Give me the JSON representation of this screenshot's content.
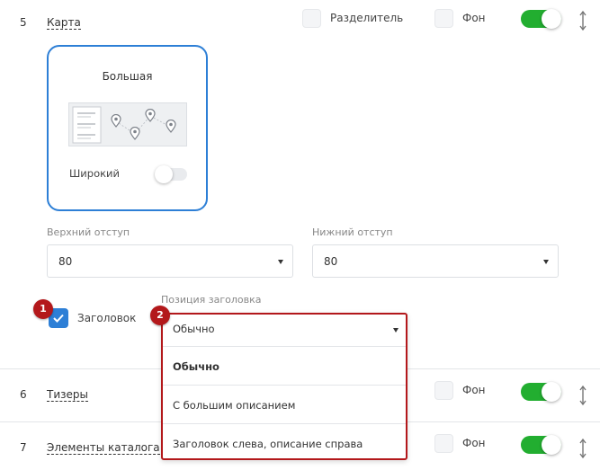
{
  "colors": {
    "accent_blue": "#2d7fd6",
    "toggle_green": "#22ae30",
    "annotation_red": "#b3181b"
  },
  "rows": [
    {
      "num": "5",
      "title": "Карта"
    },
    {
      "num": "6",
      "title": "Тизеры"
    },
    {
      "num": "7",
      "title": "Элементы каталога"
    }
  ],
  "options": {
    "divider_label": "Разделитель",
    "background_label": "Фон"
  },
  "map_card": {
    "title": "Большая",
    "wide_label": "Широкий",
    "wide_on": false
  },
  "top_margin": {
    "label": "Верхний отступ",
    "value": "80"
  },
  "bottom_margin": {
    "label": "Нижний отступ",
    "value": "80"
  },
  "heading": {
    "label": "Заголовок",
    "checked": true
  },
  "heading_position": {
    "label": "Позиция заголовка",
    "selected": "Обычно",
    "options": [
      "Обычно",
      "С большим описанием",
      "Заголовок слева, описание справа"
    ]
  },
  "annotations": [
    "1",
    "2"
  ],
  "icons": {
    "toggle": "toggle-switch-icon",
    "sort": "vertical-arrows-icon",
    "check": "check-icon",
    "dropdown_arrow": "triangle-down-icon",
    "map_pin": "map-pin-icon"
  }
}
